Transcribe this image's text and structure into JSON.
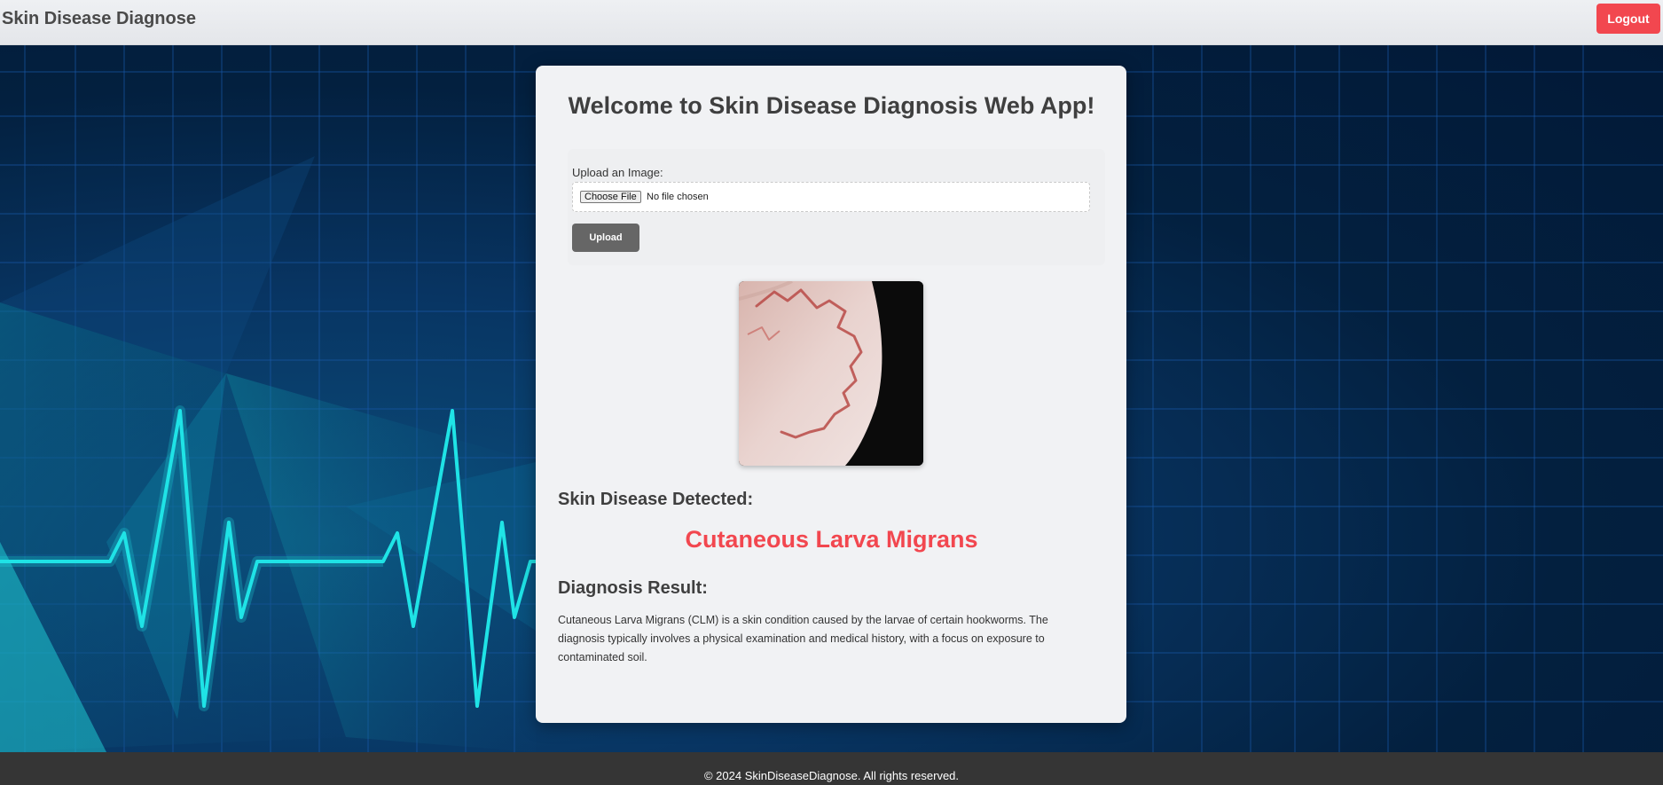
{
  "navbar": {
    "brand": "Skin Disease Diagnose",
    "logout_label": "Logout"
  },
  "main": {
    "title": "Welcome to Skin Disease Diagnosis Web App!",
    "upload": {
      "label": "Upload an Image:",
      "choose_file_label": "Choose File",
      "file_status": "No file chosen",
      "upload_button_label": "Upload"
    },
    "result": {
      "detected_heading": "Skin Disease Detected:",
      "disease_name": "Cutaneous Larva Migrans",
      "diagnosis_heading": "Diagnosis Result:",
      "description": "Cutaneous Larva Migrans (CLM) is a skin condition caused by the larvae of certain hookworms. The diagnosis typically involves a physical examination and medical history, with a focus on exposure to contaminated soil."
    }
  },
  "footer": {
    "copyright": "© 2024 SkinDiseaseDiagnose. All rights reserved."
  },
  "colors": {
    "accent": "#f2474f",
    "background_dark": "#031b3a",
    "ecg_line": "#1fe3e6",
    "footer_bg": "#353535"
  },
  "icons": [
    "uploaded-skin-image"
  ]
}
